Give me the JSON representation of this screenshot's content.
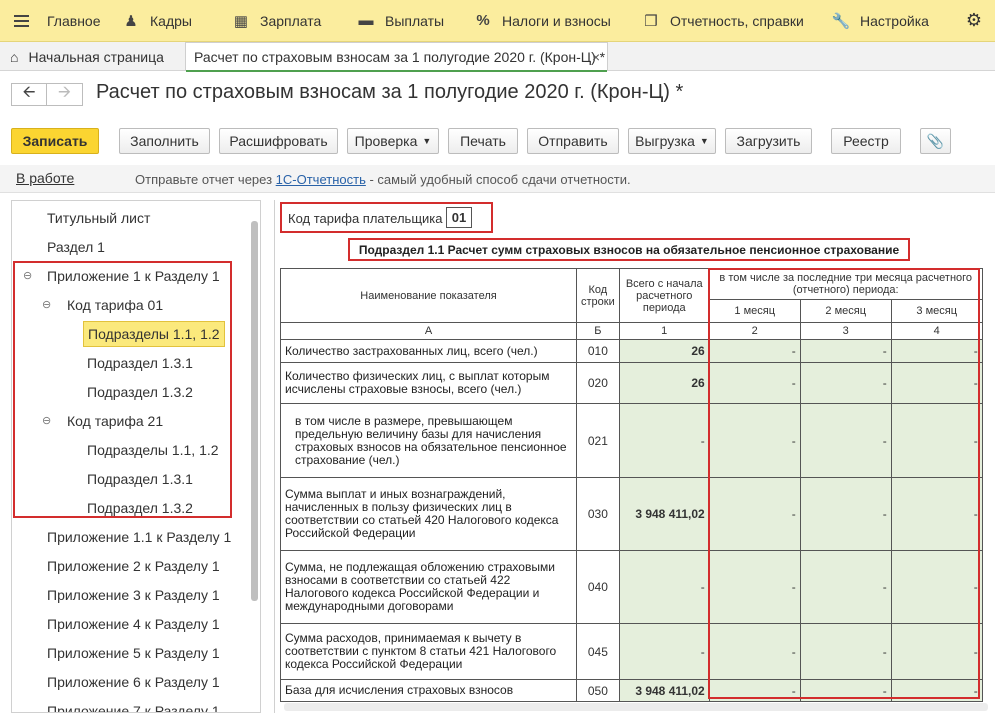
{
  "menu": [
    {
      "label": "Главное",
      "icon": "menu-icon"
    },
    {
      "label": "Кадры",
      "icon": "people-icon"
    },
    {
      "label": "Зарплата",
      "icon": "calculator-icon"
    },
    {
      "label": "Выплаты",
      "icon": "wallet-icon"
    },
    {
      "label": "Налоги и взносы",
      "icon": "percent-icon"
    },
    {
      "label": "Отчетность, справки",
      "icon": "reports-icon"
    },
    {
      "label": "Настройка",
      "icon": "wrench-icon"
    }
  ],
  "tabs": {
    "home": "Начальная страница",
    "active": "Расчет по страховым взносам за 1 полугодие 2020 г. (Крон-Ц) *"
  },
  "title": "Расчет по страховым взносам за 1 полугодие 2020 г. (Крон-Ц) *",
  "toolbar": {
    "save": "Записать",
    "fill": "Заполнить",
    "decode": "Расшифровать",
    "check": "Проверка",
    "print": "Печать",
    "send": "Отправить",
    "export": "Выгрузка",
    "load": "Загрузить",
    "registry": "Реестр"
  },
  "status": {
    "state": "В работе",
    "msg_prefix": "Отправьте отчет через ",
    "msg_link": "1С-Отчетность",
    "msg_suffix": " - самый удобный способ сдачи отчетности."
  },
  "tree": [
    "Титульный лист",
    "Раздел 1",
    "Приложение 1 к Разделу 1",
    "Код тарифа 01",
    "Подразделы 1.1, 1.2",
    "Подраздел 1.3.1",
    "Подраздел 1.3.2",
    "Код тарифа 21",
    "Подразделы 1.1, 1.2",
    "Подраздел 1.3.1",
    "Подраздел 1.3.2",
    "Приложение 1.1 к Разделу 1",
    "Приложение 2 к Разделу 1",
    "Приложение 3 к Разделу 1",
    "Приложение 4 к Разделу 1",
    "Приложение 5 к Разделу 1",
    "Приложение 6 к Разделу 1",
    "Приложение 7 к Разделу 1"
  ],
  "form": {
    "tariff_label": "Код тарифа плательщика",
    "tariff_code": "01",
    "subsection_title": "Подраздел 1.1 Расчет сумм страховых взносов на обязательное пенсионное страхование",
    "header": {
      "name": "Наименование показателя",
      "code": "Код строки",
      "total": "Всего с начала расчетного периода",
      "last3": "в том числе за последние три месяца расчетного (отчетного) периода:",
      "m1": "1 месяц",
      "m2": "2 месяц",
      "m3": "3 месяц"
    },
    "index_row": [
      "А",
      "Б",
      "1",
      "2",
      "3",
      "4"
    ],
    "rows": [
      {
        "name": "Количество застрахованных лиц, всего (чел.)",
        "code": "010",
        "total": "26",
        "m1": "-",
        "m2": "-",
        "m3": "-"
      },
      {
        "name": "Количество физических лиц, с выплат которым исчислены страховые взносы, всего (чел.)",
        "code": "020",
        "total": "26",
        "m1": "-",
        "m2": "-",
        "m3": "-"
      },
      {
        "name": "в том числе в размере, превышающем предельную величину базы для начисления страховых взносов на обязательное пенсионное страхование (чел.)",
        "code": "021",
        "total": "-",
        "m1": "-",
        "m2": "-",
        "m3": "-"
      },
      {
        "name": "Сумма выплат и иных вознаграждений, начисленных в пользу физических лиц в соответствии со статьей 420 Налогового кодекса Российской Федерации",
        "code": "030",
        "total": "3 948 411,02",
        "m1": "-",
        "m2": "-",
        "m3": "-"
      },
      {
        "name": "Сумма, не подлежащая обложению страховыми взносами в соответствии со статьей 422 Налогового кодекса Российской Федерации и международными договорами",
        "code": "040",
        "total": "-",
        "m1": "-",
        "m2": "-",
        "m3": "-"
      },
      {
        "name": "Сумма расходов, принимаемая к вычету в соответствии с пунктом 8 статьи 421 Налогового кодекса Российской Федерации",
        "code": "045",
        "total": "-",
        "m1": "-",
        "m2": "-",
        "m3": "-"
      },
      {
        "name": "База для исчисления страховых взносов",
        "code": "050",
        "total": "3 948 411,02",
        "m1": "-",
        "m2": "-",
        "m3": "-"
      }
    ]
  }
}
